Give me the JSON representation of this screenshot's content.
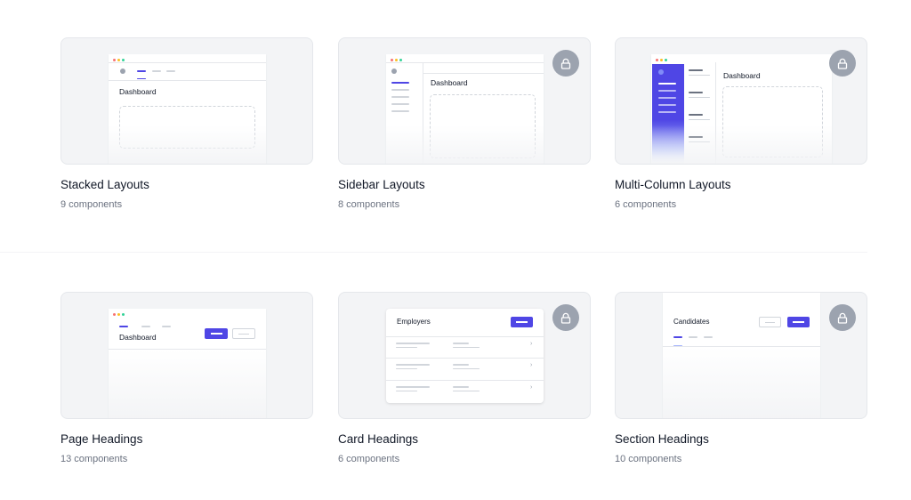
{
  "colors": {
    "accent": "#4f46e5",
    "thumb_bg": "#f3f4f6",
    "lock_bg": "#9ca3af",
    "muted_text": "#6b7280"
  },
  "categories": [
    {
      "title": "Stacked Layouts",
      "count": "9 components",
      "locked": false,
      "preview_label": "Dashboard"
    },
    {
      "title": "Sidebar Layouts",
      "count": "8 components",
      "locked": true,
      "preview_label": "Dashboard"
    },
    {
      "title": "Multi-Column Layouts",
      "count": "6 components",
      "locked": true,
      "preview_label": "Dashboard"
    },
    {
      "title": "Page Headings",
      "count": "13 components",
      "locked": false,
      "preview_label": "Dashboard"
    },
    {
      "title": "Card Headings",
      "count": "6 components",
      "locked": true,
      "preview_label": "Employers"
    },
    {
      "title": "Section Headings",
      "count": "10 components",
      "locked": true,
      "preview_label": "Candidates"
    }
  ]
}
